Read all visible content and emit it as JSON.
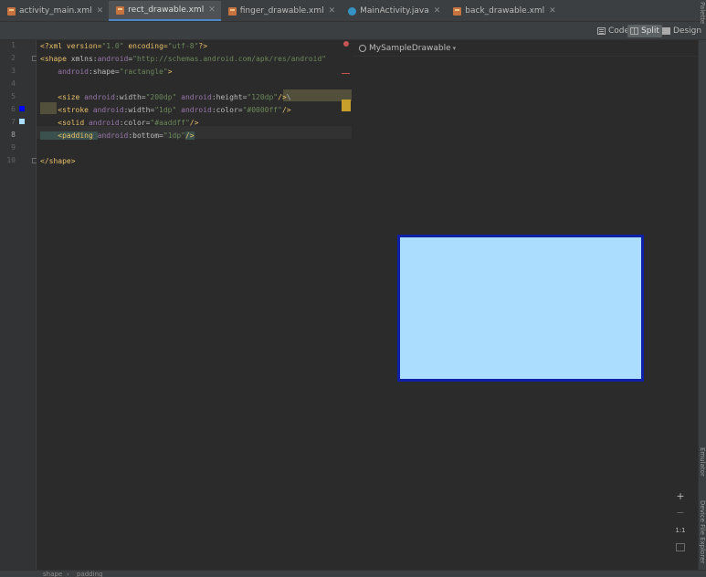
{
  "tabs": [
    {
      "label": "activity_main.xml",
      "icon": "xml-file-icon",
      "active": false
    },
    {
      "label": "rect_drawable.xml",
      "icon": "xml-file-icon",
      "active": true
    },
    {
      "label": "finger_drawable.xml",
      "icon": "xml-file-icon",
      "active": false
    },
    {
      "label": "MainActivity.java",
      "icon": "java-class-icon",
      "active": false
    },
    {
      "label": "back_drawable.xml",
      "icon": "xml-file-icon",
      "active": false
    }
  ],
  "view_modes": {
    "code": "Code",
    "split": "Split",
    "design": "Design",
    "selected": "Split"
  },
  "gutter": {
    "line_numbers": [
      "1",
      "2",
      "3",
      "4",
      "5",
      "6",
      "7",
      "8",
      "9",
      "10"
    ],
    "current_line": "8",
    "swatches": [
      {
        "line": "6",
        "color": "#0000ff"
      },
      {
        "line": "7",
        "color": "#aaddff"
      }
    ]
  },
  "code": {
    "l1": {
      "a": "<?xml version=",
      "b": "\"1.0\"",
      "c": " encoding=",
      "d": "\"utf-8\"",
      "e": "?>"
    },
    "l2": {
      "a": "<shape ",
      "b": "xmlns:",
      "c": "android",
      "d": "=",
      "e": "\"http://schemas.android.com/apk/res/android\""
    },
    "l3": {
      "a": "    android",
      "b": ":shape=",
      "c": "\"ractangle\"",
      "d": ">"
    },
    "l5": {
      "a": "    <size ",
      "b": "android",
      "c": ":width=",
      "d": "\"200dp\"",
      "e": " android",
      "f": ":height=",
      "g": "\"120dp\"",
      "h": "/>",
      "i": "\\"
    },
    "l6": {
      "a": "    <stroke ",
      "b": "android",
      "c": ":width=",
      "d": "\"1dp\"",
      "e": " android",
      "f": ":color=",
      "g": "\"#0000ff\"",
      "h": "/>"
    },
    "l7": {
      "a": "    <solid ",
      "b": "android",
      "c": ":color=",
      "d": "\"#aaddff\"",
      "e": "/>"
    },
    "l8": {
      "a": "    <padding ",
      "b": "android",
      "c": ":bottom=",
      "d": "\"1dp\"",
      "e": "/>"
    },
    "l10": {
      "a": "</shape>"
    }
  },
  "preview": {
    "title": "MySampleDrawable",
    "drawable_fill": "#aaddff",
    "drawable_stroke": "#0f1fa6"
  },
  "zoom_controls": {
    "zoom_in": "+",
    "zoom_out": "−",
    "actual_size": "1:1"
  },
  "right_sidebar": {
    "top": "Palette",
    "middle": "Emulator",
    "bottom": "Device File Explorer"
  },
  "breadcrumb": [
    "shape",
    "padding"
  ],
  "colors": {
    "editor_bg": "#2b2b2b",
    "panel_bg": "#3c3f41",
    "tag": "#e8bf6a",
    "namespace": "#9876aa",
    "string": "#6a8759",
    "active_tab_underline": "#4a88c7"
  }
}
